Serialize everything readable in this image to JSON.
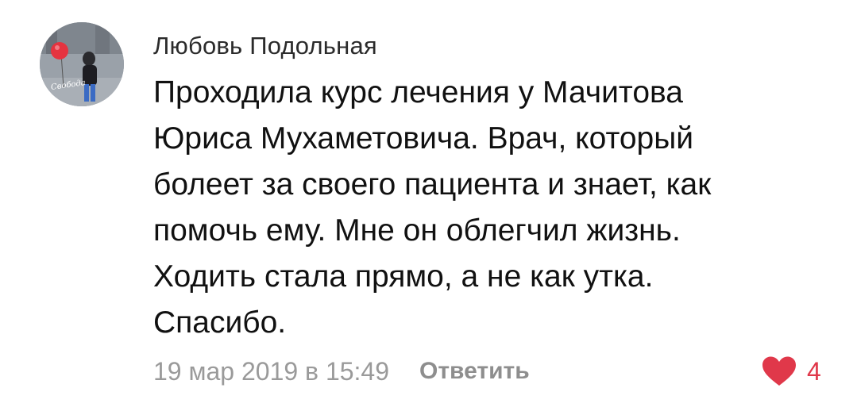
{
  "comment": {
    "author": "Любовь Подольная",
    "avatar_caption": "Свобода",
    "text_lines": [
      "Проходила курс лечения у Мачитова",
      "Юриса  Мухаметовича. Врач, который",
      "болеет за своего пациента и знает, как",
      "помочь ему. Мне он облегчил жизнь.",
      "Ходить стала прямо, а не как утка.",
      "Спасибо."
    ],
    "date": "19 мар 2019 в 15:49",
    "reply_label": "Ответить",
    "likes": "4",
    "like_icon": "heart-icon",
    "colors": {
      "like": "#e0384a",
      "meta": "#9a9a9a",
      "author": "#2b2b2b"
    }
  }
}
